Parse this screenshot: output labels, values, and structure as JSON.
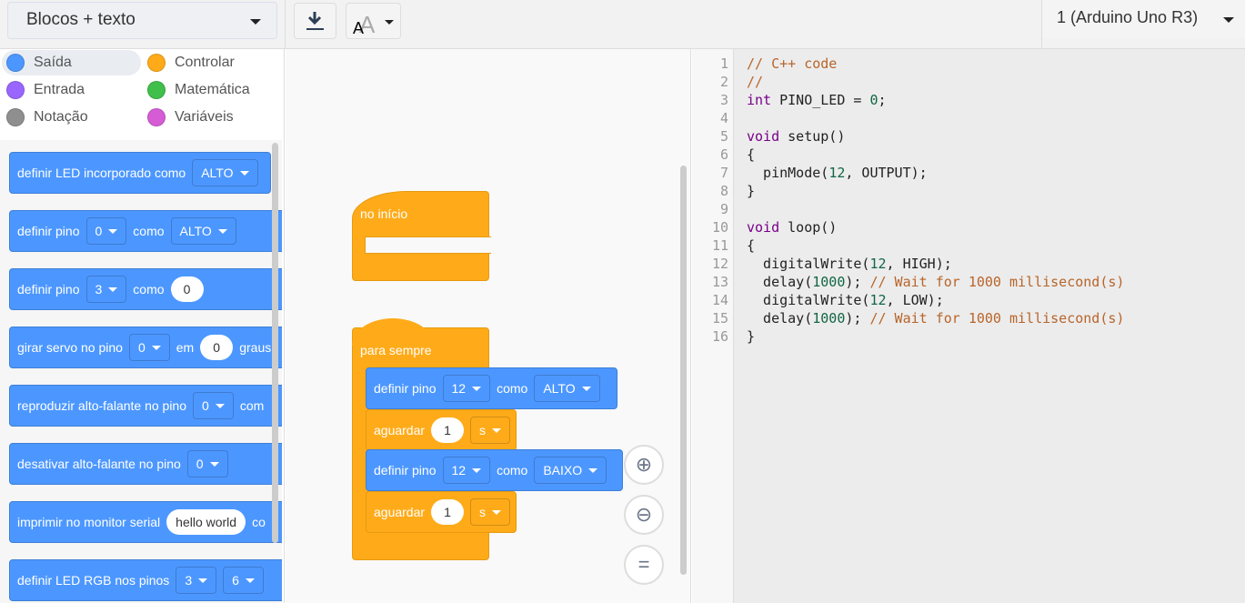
{
  "toolbar": {
    "mode": "Blocos + texto",
    "download_icon": "download-icon",
    "font_icon": "font-size-icon",
    "board": "1 (Arduino Uno R3)"
  },
  "categories": [
    {
      "label": "Saída",
      "color": "#4c97ff"
    },
    {
      "label": "Controlar",
      "color": "#ffab19"
    },
    {
      "label": "Entrada",
      "color": "#9966ff"
    },
    {
      "label": "Matemática",
      "color": "#40bf4a"
    },
    {
      "label": "Notação",
      "color": "#8f8f8f"
    },
    {
      "label": "Variáveis",
      "color": "#d65cd6"
    }
  ],
  "palette": [
    {
      "text": "definir LED incorporado como",
      "dd": "ALTO"
    },
    {
      "text": "definir pino",
      "dd": "0",
      "mid": "como",
      "dd2": "ALTO"
    },
    {
      "text": "definir pino",
      "dd": "3",
      "mid": "como",
      "num": "0"
    },
    {
      "text": "girar servo no pino",
      "dd": "0",
      "mid": "em",
      "num": "0",
      "tail": "graus"
    },
    {
      "text": "reproduzir alto-falante no pino",
      "dd": "0",
      "tail": "com"
    },
    {
      "text": "desativar alto-falante no pino",
      "dd": "0"
    },
    {
      "text": "imprimir no monitor serial",
      "str": "hello world",
      "tail": "co"
    },
    {
      "text": "definir LED RGB nos pinos",
      "dd": "3",
      "dd2": "6"
    }
  ],
  "script": {
    "start": "no início",
    "forever": "para sempre",
    "b1": {
      "text": "definir pino",
      "pin": "12",
      "mid": "como",
      "val": "ALTO"
    },
    "w1": {
      "text": "aguardar",
      "num": "1",
      "unit": "s"
    },
    "b2": {
      "text": "definir pino",
      "pin": "12",
      "mid": "como",
      "val": "BAIXO"
    },
    "w2": {
      "text": "aguardar",
      "num": "1",
      "unit": "s"
    }
  },
  "zoom": {
    "in": "zoom-in-icon",
    "out": "zoom-out-icon",
    "reset": "zoom-reset-icon"
  },
  "code": [
    [
      {
        "t": "// C++ code",
        "c": "c"
      }
    ],
    [
      {
        "t": "//",
        "c": "c"
      }
    ],
    [
      {
        "t": "int",
        "c": "k"
      },
      {
        "t": " PINO_LED = "
      },
      {
        "t": "0",
        "c": "n"
      },
      {
        "t": ";"
      }
    ],
    [],
    [
      {
        "t": "void",
        "c": "k"
      },
      {
        "t": " setup()"
      }
    ],
    [
      {
        "t": "{"
      }
    ],
    [
      {
        "t": "  pinMode("
      },
      {
        "t": "12",
        "c": "n"
      },
      {
        "t": ", OUTPUT);"
      }
    ],
    [
      {
        "t": "}"
      }
    ],
    [],
    [
      {
        "t": "void",
        "c": "k"
      },
      {
        "t": " loop()"
      }
    ],
    [
      {
        "t": "{"
      }
    ],
    [
      {
        "t": "  digitalWrite("
      },
      {
        "t": "12",
        "c": "n"
      },
      {
        "t": ", HIGH);"
      }
    ],
    [
      {
        "t": "  delay("
      },
      {
        "t": "1000",
        "c": "n"
      },
      {
        "t": "); "
      },
      {
        "t": "// Wait for 1000 millisecond(s)",
        "c": "c"
      }
    ],
    [
      {
        "t": "  digitalWrite("
      },
      {
        "t": "12",
        "c": "n"
      },
      {
        "t": ", LOW);"
      }
    ],
    [
      {
        "t": "  delay("
      },
      {
        "t": "1000",
        "c": "n"
      },
      {
        "t": "); "
      },
      {
        "t": "// Wait for 1000 millisecond(s)",
        "c": "c"
      }
    ],
    [
      {
        "t": "}"
      }
    ]
  ]
}
